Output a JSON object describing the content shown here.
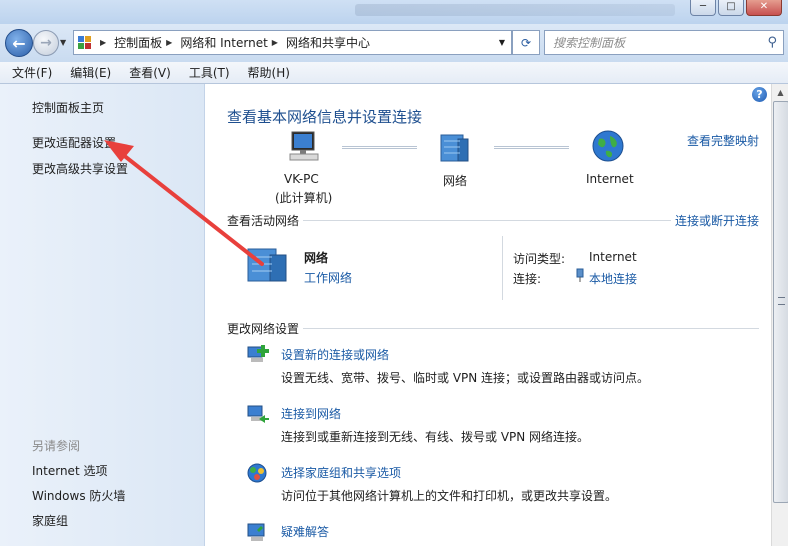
{
  "window": {
    "title_blurred": "",
    "controls": [
      "minimize",
      "maximize",
      "close"
    ]
  },
  "address": {
    "back_icon": "back-arrow-icon",
    "breadcrumbs": [
      "控制面板",
      "网络和 Internet",
      "网络和共享中心"
    ],
    "search_placeholder": "搜索控制面板"
  },
  "menu": [
    "文件(F)",
    "编辑(E)",
    "查看(V)",
    "工具(T)",
    "帮助(H)"
  ],
  "sidebar": {
    "home": "控制面板主页",
    "links": [
      "更改适配器设置",
      "更改高级共享设置"
    ],
    "see_also_title": "另请参阅",
    "see_also": [
      "Internet 选项",
      "Windows 防火墙",
      "家庭组"
    ]
  },
  "main": {
    "heading": "查看基本网络信息并设置连接",
    "full_map": "查看完整映射",
    "map": {
      "computer_name": "VK-PC",
      "computer_sub": "(此计算机)",
      "network": "网络",
      "internet": "Internet"
    },
    "active_title": "查看活动网络",
    "connect_link": "连接或断开连接",
    "active_network": {
      "name": "网络",
      "type": "工作网络",
      "access_label": "访问类型:",
      "access_value": "Internet",
      "conn_label": "连接:",
      "conn_value": "本地连接"
    },
    "change_title": "更改网络设置",
    "tasks": [
      {
        "title": "设置新的连接或网络",
        "desc": "设置无线、宽带、拨号、临时或 VPN 连接；或设置路由器或访问点。"
      },
      {
        "title": "连接到网络",
        "desc": "连接到或重新连接到无线、有线、拨号或 VPN 网络连接。"
      },
      {
        "title": "选择家庭组和共享选项",
        "desc": "访问位于其他网络计算机上的文件和打印机，或更改共享设置。"
      },
      {
        "title": "疑难解答",
        "desc": ""
      }
    ]
  },
  "annotation": {
    "color": "#e8403c"
  }
}
